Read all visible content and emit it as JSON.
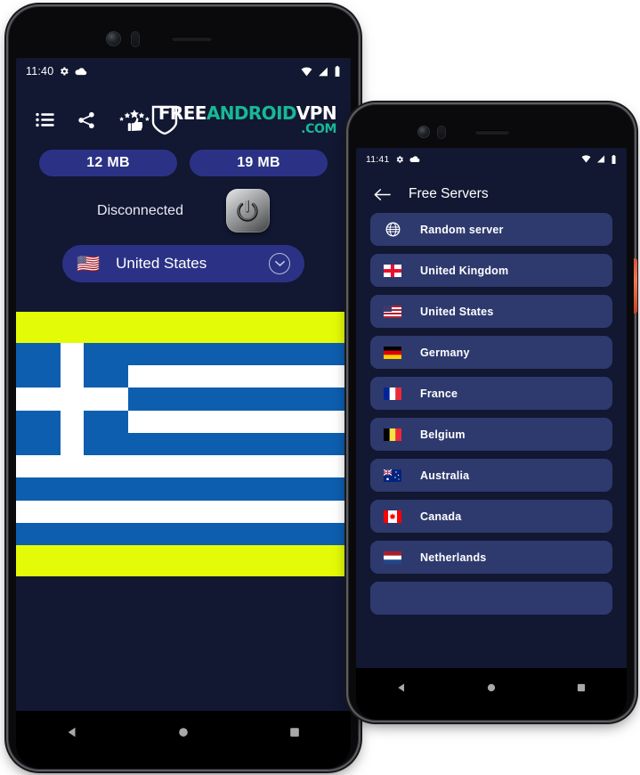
{
  "phone_left": {
    "status_bar": {
      "time": "11:40",
      "icons_left": [
        "gear-icon",
        "cloud-icon"
      ],
      "icons_right": [
        "wifi-icon",
        "signal-icon",
        "battery-icon"
      ]
    },
    "header": {
      "actions": [
        "list-icon",
        "share-icon",
        "rate-icon"
      ],
      "logo": {
        "free": "FREE",
        "android": "ANDROID",
        "vpn": "VPN",
        "com": ".COM",
        "shield": "shield-icon"
      }
    },
    "badges": [
      {
        "label": "12 MB",
        "name": "download-badge"
      },
      {
        "label": "19 MB",
        "name": "upload-badge"
      }
    ],
    "status_text": "Disconnected",
    "power_button": "power-icon",
    "country_select": {
      "flag": "🇺🇸",
      "name": "United States",
      "chevron": "chevron-down-icon"
    },
    "banner": {
      "bar_color": "#e4fb07",
      "flag": "greece-flag",
      "flag_blue": "#0d5eaf",
      "flag_white": "#ffffff"
    },
    "nav": [
      "back-triangle-icon",
      "home-circle-icon",
      "recents-square-icon"
    ]
  },
  "phone_right": {
    "status_bar": {
      "time": "11:41",
      "icons_left": [
        "gear-icon",
        "cloud-icon"
      ],
      "icons_right": [
        "wifi-icon",
        "signal-icon",
        "battery-icon"
      ]
    },
    "header": {
      "back": "back-arrow-icon",
      "title": "Free Servers"
    },
    "servers": [
      {
        "flag": "globe",
        "label": "Random server"
      },
      {
        "flag": "🏴󠁧󠁢󠁥󠁮󠁧󠁿",
        "label": "United Kingdom"
      },
      {
        "flag": "🇺🇸",
        "label": "United States"
      },
      {
        "flag": "🇩🇪",
        "label": "Germany"
      },
      {
        "flag": "🇫🇷",
        "label": "France"
      },
      {
        "flag": "🇧🇪",
        "label": "Belgium"
      },
      {
        "flag": "🇦🇺",
        "label": "Australia"
      },
      {
        "flag": "🇨🇦",
        "label": "Canada"
      },
      {
        "flag": "🇳🇱",
        "label": "Netherlands"
      },
      {
        "flag": "",
        "label": ""
      }
    ],
    "nav": [
      "back-triangle-icon",
      "home-circle-icon",
      "recents-square-icon"
    ],
    "side_button_color": "#e06a4a"
  },
  "colors": {
    "screen_bg": "#121732",
    "accent_blue": "#2b3285",
    "list_item": "#2e3a6e",
    "logo_green": "#17b897",
    "banner_yellow": "#e4fb07",
    "flag_blue": "#0d5eaf"
  }
}
